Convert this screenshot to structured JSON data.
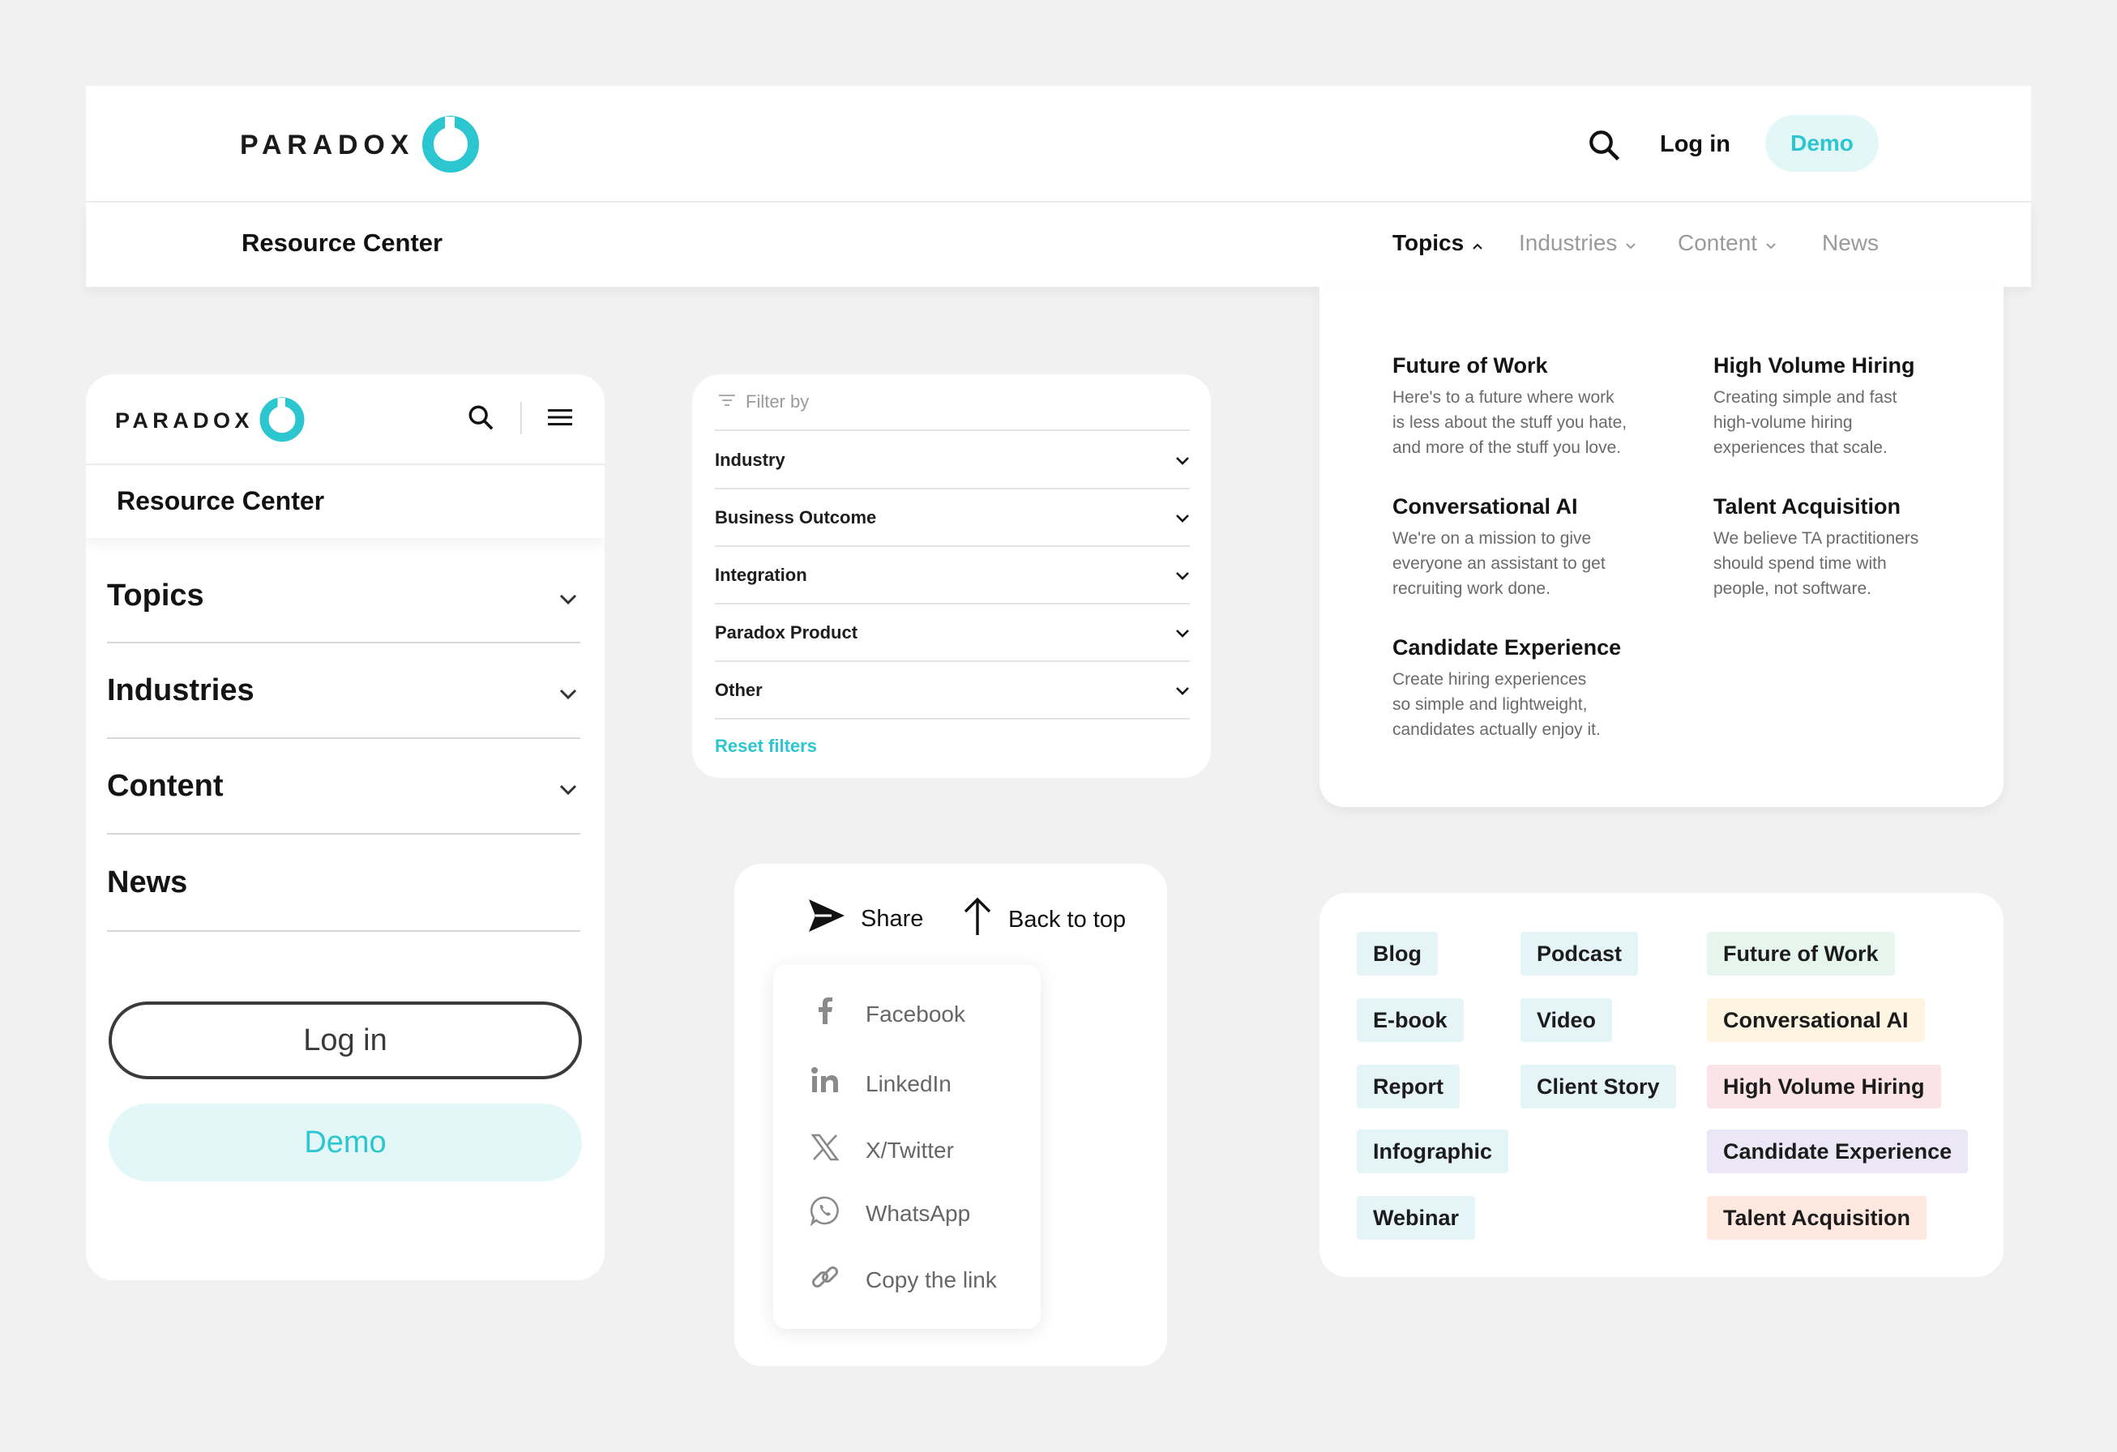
{
  "brand": {
    "name": "PARADOX",
    "accent": "#2cc6d0",
    "accent_bg": "#e3f7f8"
  },
  "header": {
    "login": "Log in",
    "demo": "Demo",
    "section_title": "Resource Center",
    "nav": [
      {
        "label": "Topics",
        "state": "open"
      },
      {
        "label": "Industries"
      },
      {
        "label": "Content"
      },
      {
        "label": "News"
      }
    ]
  },
  "mobile": {
    "section_title": "Resource Center",
    "items": [
      "Topics",
      "Industries",
      "Content",
      "News"
    ],
    "login": "Log in",
    "demo": "Demo"
  },
  "filter": {
    "label": "Filter by",
    "rows": [
      "Industry",
      "Business Outcome",
      "Integration",
      "Paradox Product",
      "Other"
    ],
    "reset": "Reset filters"
  },
  "topics": [
    {
      "title": "Future of Work",
      "desc": [
        "Here's to a future where work",
        "is less about the stuff you hate,",
        "and more of the stuff you love."
      ]
    },
    {
      "title": "High Volume Hiring",
      "desc": [
        "Creating simple and fast",
        "high-volume hiring",
        "experiences that scale."
      ]
    },
    {
      "title": "Conversational AI",
      "desc": [
        "We're on a mission to give",
        "everyone an assistant to get",
        "recruiting work done."
      ]
    },
    {
      "title": "Talent Acquisition",
      "desc": [
        "We believe TA practitioners",
        "should spend time with",
        "people, not software."
      ]
    },
    {
      "title": "Candidate Experience",
      "desc": [
        "Create hiring experiences",
        "so simple and lightweight,",
        "candidates actually enjoy it."
      ]
    }
  ],
  "share": {
    "share_label": "Share",
    "back_label": "Back to top",
    "items": [
      {
        "label": "Facebook",
        "icon": "facebook-icon"
      },
      {
        "label": "LinkedIn",
        "icon": "linkedin-icon"
      },
      {
        "label": "X/Twitter",
        "icon": "x-twitter-icon"
      },
      {
        "label": "WhatsApp",
        "icon": "whatsapp-icon"
      },
      {
        "label": "Copy the link",
        "icon": "link-icon"
      }
    ]
  },
  "tags": {
    "content": [
      "Blog",
      "E-book",
      "Report",
      "Infographic",
      "Webinar"
    ],
    "content2": [
      "Podcast",
      "Video",
      "Client Story"
    ],
    "topics": [
      {
        "label": "Future of Work",
        "color": "#e6f6ee"
      },
      {
        "label": "Conversational AI",
        "color": "#fdf5e2"
      },
      {
        "label": "High Volume Hiring",
        "color": "#fbe4e8"
      },
      {
        "label": "Candidate Experience",
        "color": "#ebe7f7"
      },
      {
        "label": "Talent Acquisition",
        "color": "#fde7df"
      }
    ],
    "content_color": "#e5f4f6"
  }
}
